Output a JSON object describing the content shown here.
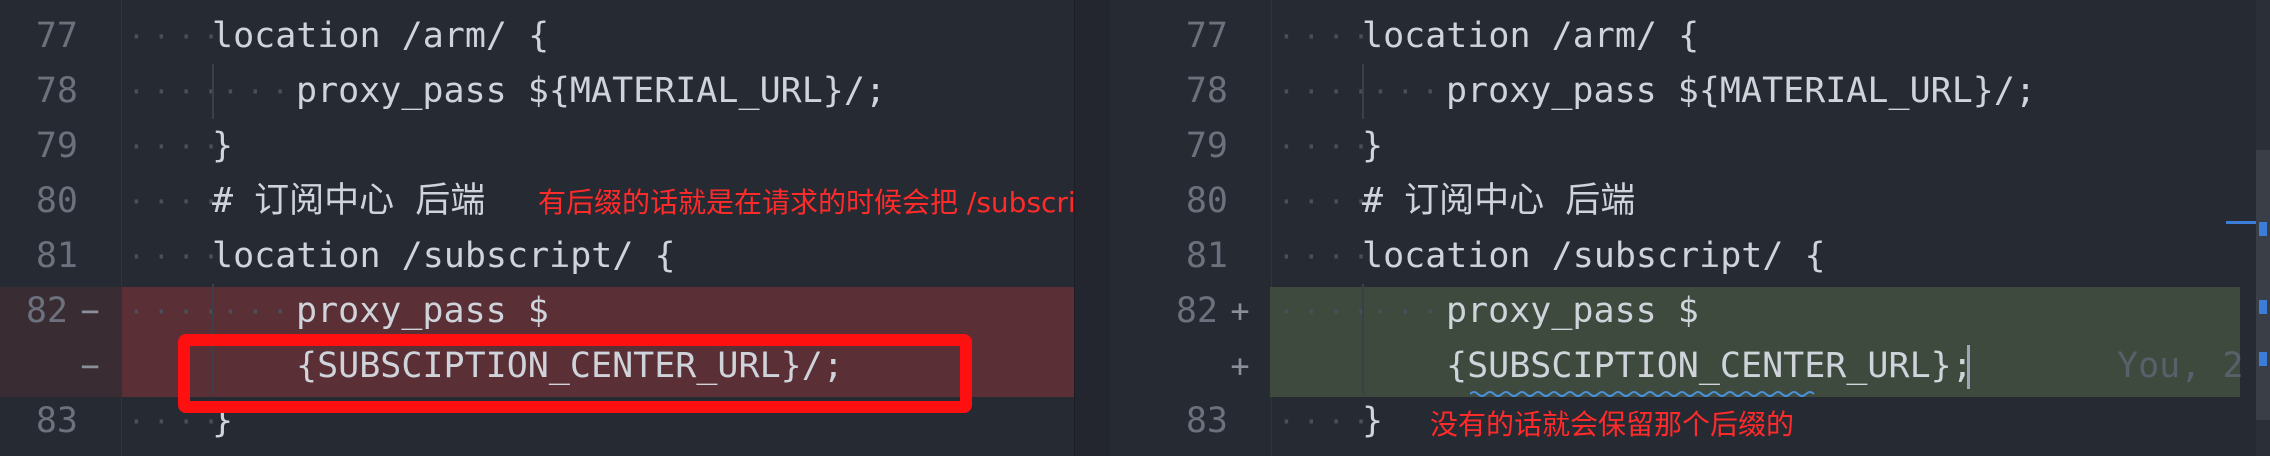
{
  "left": {
    "lines": [
      {
        "num": "77",
        "marker": "",
        "code": "location /arm/ {"
      },
      {
        "num": "78",
        "marker": "",
        "code": "proxy_pass ${MATERIAL_URL}/;"
      },
      {
        "num": "79",
        "marker": "",
        "code": "}"
      },
      {
        "num": "80",
        "marker": "",
        "code": "# 订阅中心 后端"
      },
      {
        "num": "81",
        "marker": "",
        "code": "location /subscript/ {"
      },
      {
        "num": "82",
        "marker": "−",
        "code": "proxy_pass $"
      },
      {
        "num": "",
        "marker": "−",
        "code": "{SUBSCIPTION_CENTER_URL}/;"
      },
      {
        "num": "83",
        "marker": "",
        "code": "}"
      }
    ],
    "annotation": "有后缀的话就是在请求的时候会把 /subscript去掉"
  },
  "right": {
    "lines": [
      {
        "num": "77",
        "marker": "",
        "code": "location /arm/ {"
      },
      {
        "num": "78",
        "marker": "",
        "code": "proxy_pass ${MATERIAL_URL}/;"
      },
      {
        "num": "79",
        "marker": "",
        "code": "}"
      },
      {
        "num": "80",
        "marker": "",
        "code": "# 订阅中心 后端"
      },
      {
        "num": "81",
        "marker": "",
        "code": "location /subscript/ {"
      },
      {
        "num": "82",
        "marker": "+",
        "code": "proxy_pass $"
      },
      {
        "num": "",
        "marker": "+",
        "code": "{SUBSCIPTION_CENTER_URL};"
      },
      {
        "num": "83",
        "marker": "",
        "code": "}"
      }
    ],
    "annotation": "没有的话就会保留那个后缀的",
    "blame": "You, 2"
  },
  "arrow_icon": "arrow-right-icon",
  "colors": {
    "deleted_bg": "#5a2f35",
    "added_bg": "#3d4a3d",
    "annotation": "#ff2a2a",
    "highlight_box": "#ff1010"
  }
}
